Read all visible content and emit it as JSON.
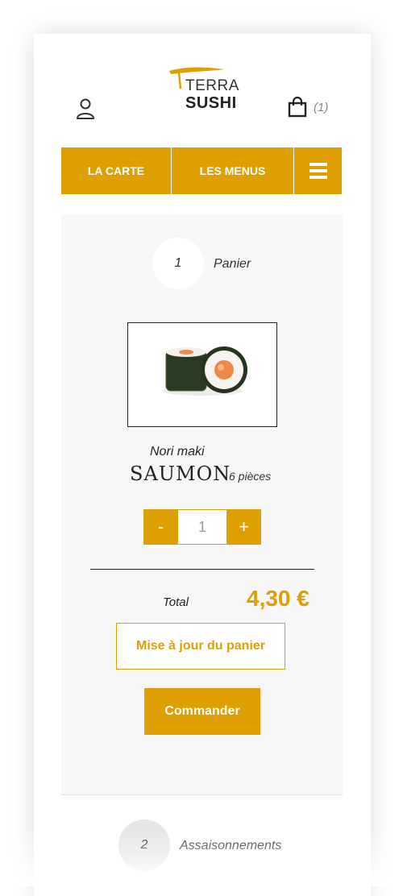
{
  "brand": {
    "line1": "TERRA",
    "line2": "SUSHI"
  },
  "header": {
    "cart_count": "(1)",
    "icons": [
      "user-icon",
      "shopping-bag-icon"
    ]
  },
  "nav": {
    "items": [
      {
        "label": "LA CARTE"
      },
      {
        "label": "LES MENUS"
      }
    ],
    "menu_icon": "hamburger-menu-icon"
  },
  "steps": [
    {
      "number": "1",
      "label": "Panier"
    },
    {
      "number": "2",
      "label": "Assaisonnements"
    }
  ],
  "product": {
    "category": "Nori maki",
    "name": "SAUMON",
    "pieces": "6 pièces",
    "quantity": "1",
    "decrement_label": "-",
    "increment_label": "+"
  },
  "summary": {
    "total_label": "Total",
    "total_value": "4,30 €",
    "update_label": "Mise à jour du panier",
    "order_label": "Commander"
  },
  "colors": {
    "accent": "#dda000",
    "panel": "#f7f7f7"
  }
}
